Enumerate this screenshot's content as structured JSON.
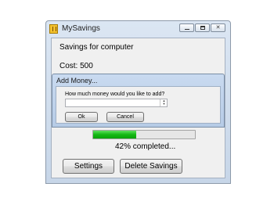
{
  "window": {
    "title": "MySavings",
    "icon": "piggy-bank-icon"
  },
  "main": {
    "savings_title": "Savings for computer",
    "cost_label": "Cost: 500",
    "progress": {
      "percent": 42,
      "text": "42% completed..."
    },
    "buttons": {
      "settings": "Settings",
      "delete": "Delete Savings"
    }
  },
  "dialog": {
    "title": "Add Money...",
    "prompt": "How much money would you like to add?",
    "input_value": "",
    "ok_label": "Ok",
    "cancel_label": "Cancel"
  },
  "caption_buttons": [
    "minimize-icon",
    "maximize-icon",
    "close-icon"
  ]
}
